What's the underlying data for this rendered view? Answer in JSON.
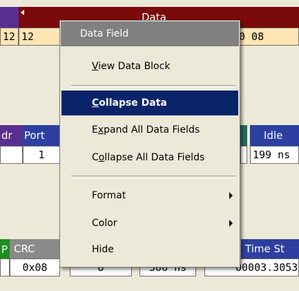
{
  "top": {
    "header_label": "Data",
    "value_left": "12",
    "value_right": "0 08"
  },
  "mid": {
    "addr_label": "dr",
    "port_label": "Port",
    "port_value": "1",
    "idle_label": "Idle",
    "idle_value": "199 ns"
  },
  "bottom": {
    "p_label": "P",
    "crc_label": "CRC",
    "crc_value": "0x08",
    "col2_value": "8",
    "col3_value": "366 ns",
    "time_label": "Time St",
    "time_value": "00003.3053"
  },
  "menu": {
    "title": "Data Field",
    "items": [
      {
        "pre": "",
        "key": "V",
        "post": "iew Data Block"
      },
      {
        "pre": "",
        "key": "C",
        "post": "ollapse Data"
      },
      {
        "pre": "E",
        "key": "x",
        "post": "pand All Data Fields"
      },
      {
        "pre": "C",
        "key": "o",
        "post": "llapse All Data Fields"
      },
      {
        "pre": "Format",
        "key": "",
        "post": ""
      },
      {
        "pre": "Color",
        "key": "",
        "post": ""
      },
      {
        "pre": "Hide",
        "key": "",
        "post": ""
      }
    ]
  },
  "colors": {
    "maroon": "#7b0a0a",
    "purple": "#5a2d91",
    "blue": "#2d3fa0",
    "teal": "#246a63",
    "gray": "#8a8a8a",
    "green": "#1e8c1e",
    "menu_highlight": "#0a246a"
  }
}
